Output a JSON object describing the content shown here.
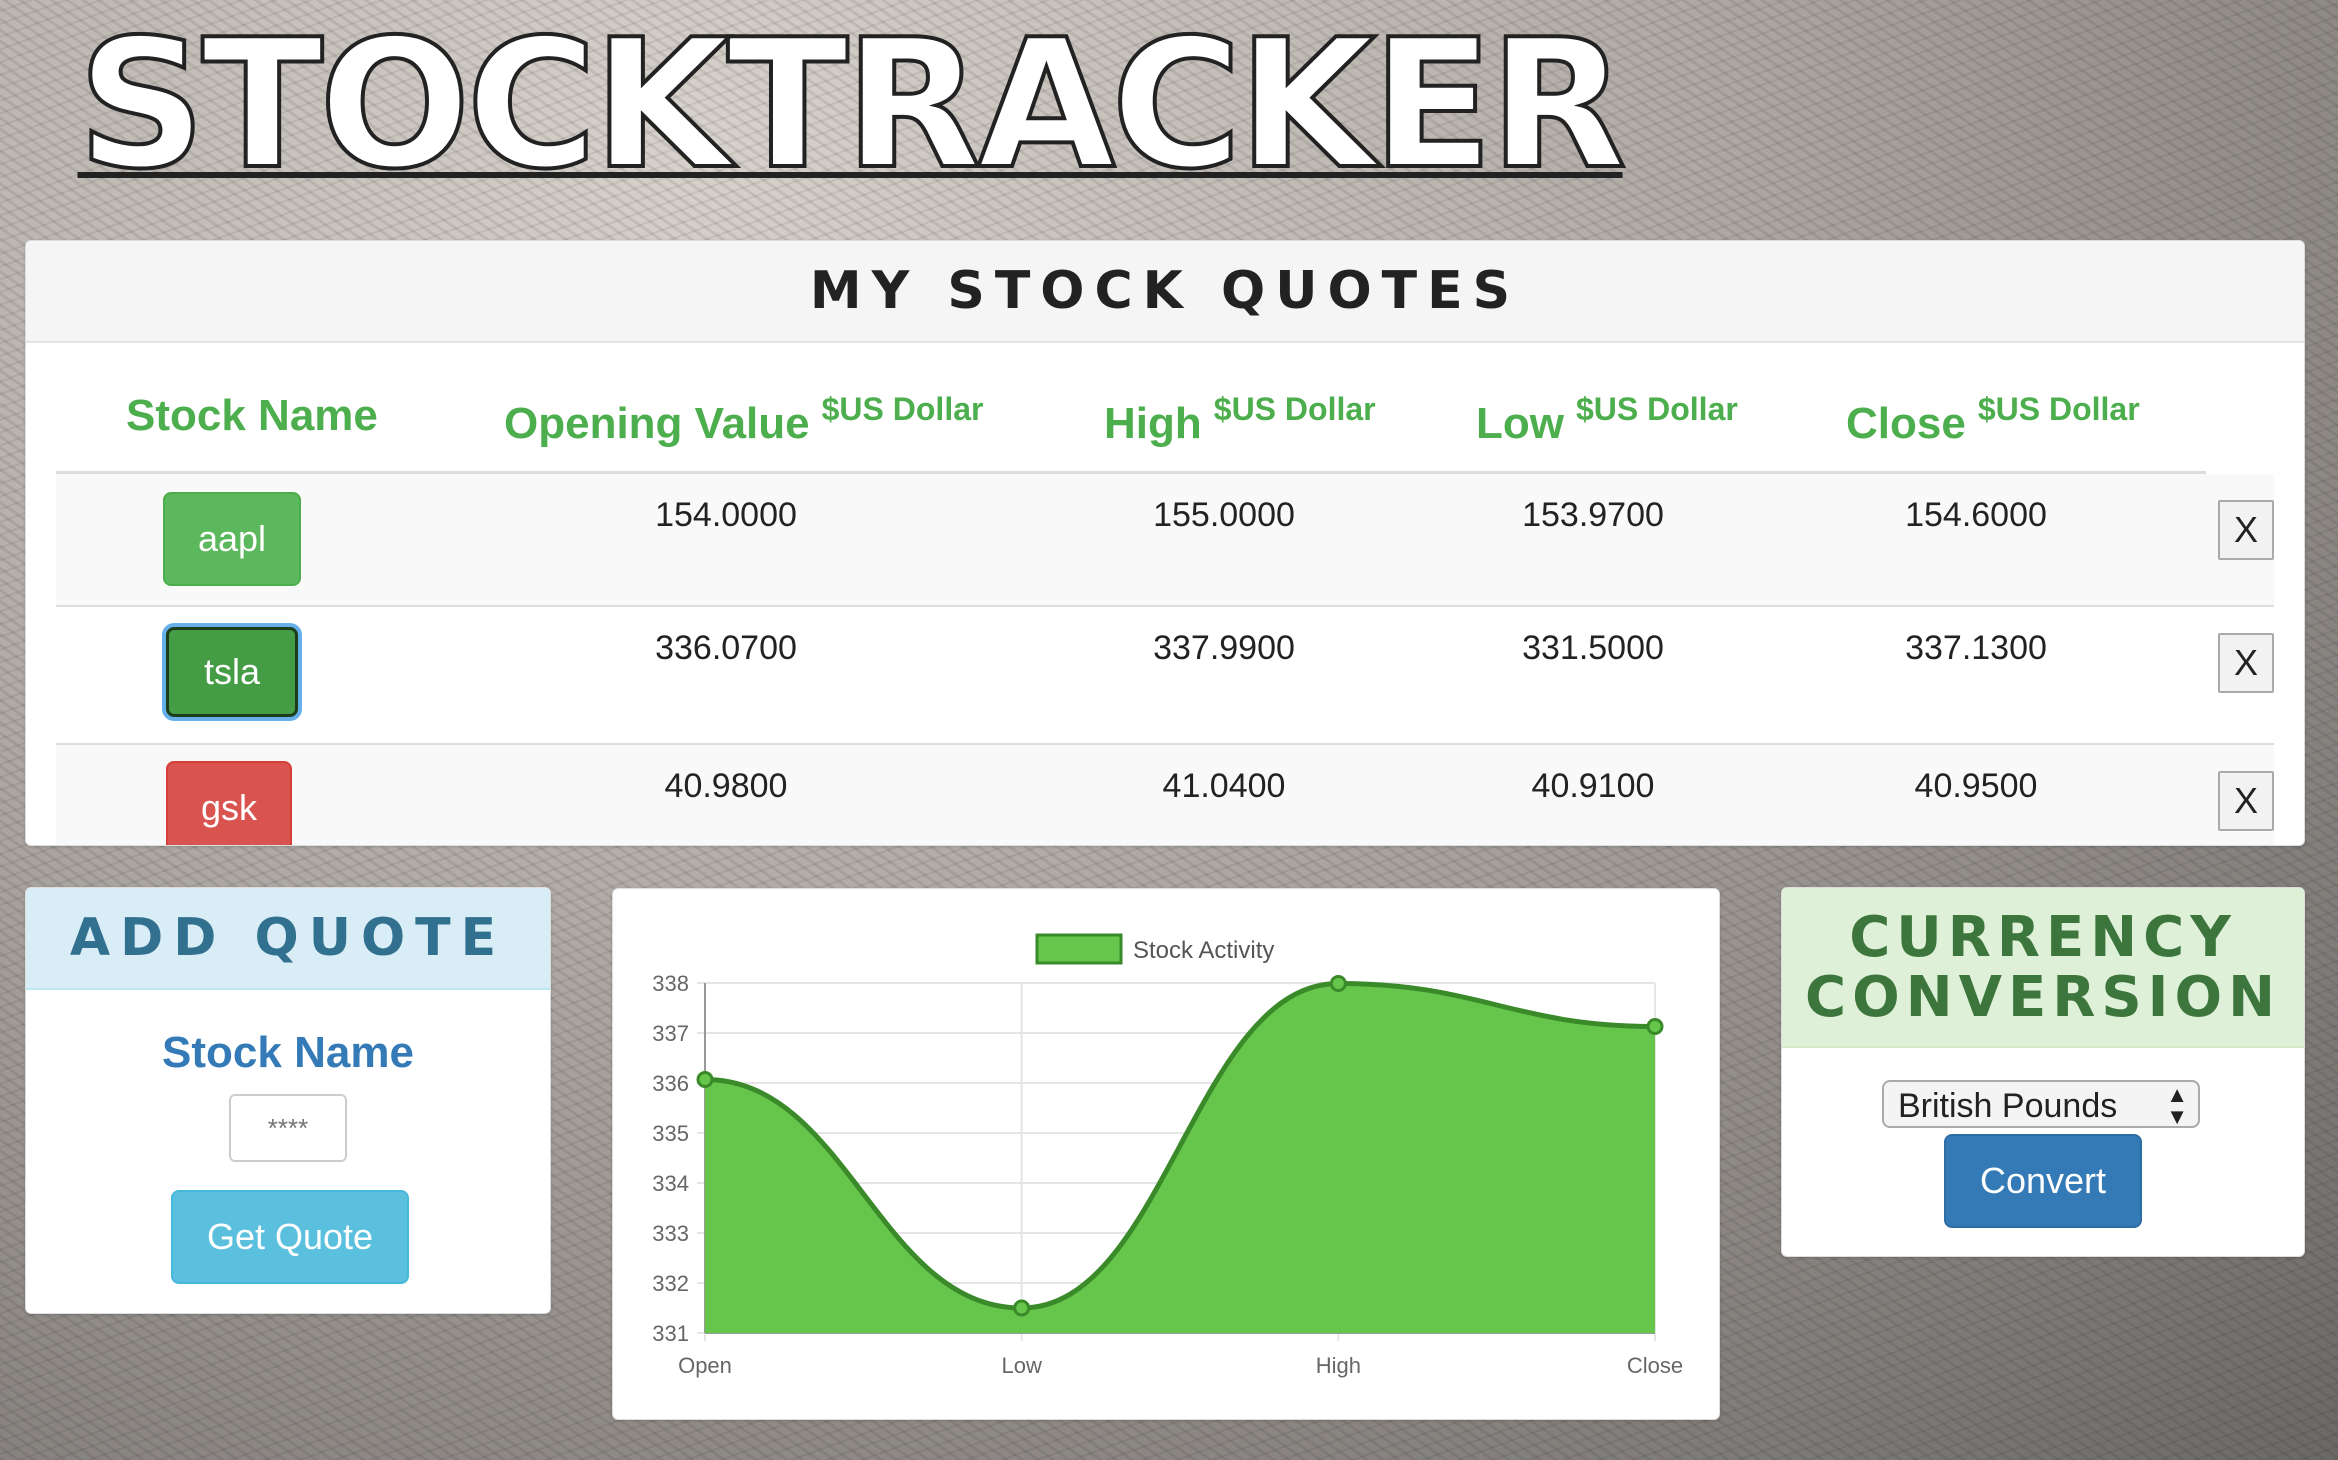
{
  "app": {
    "title": "STOCKTRACKER"
  },
  "quotes": {
    "heading": "MY STOCK QUOTES",
    "columns": {
      "name": "Stock Name",
      "open": "Opening Value",
      "high": "High",
      "low": "Low",
      "close": "Close",
      "unit": "$US Dollar"
    },
    "remove_label": "X",
    "rows": [
      {
        "symbol": "aapl",
        "open": "154.0000",
        "high": "155.0000",
        "low": "153.9700",
        "close": "154.6000"
      },
      {
        "symbol": "tsla",
        "open": "336.0700",
        "high": "337.9900",
        "low": "331.5000",
        "close": "337.1300"
      },
      {
        "symbol": "gsk",
        "open": "40.9800",
        "high": "41.0400",
        "low": "40.9100",
        "close": "40.9500"
      }
    ]
  },
  "add_quote": {
    "heading": "ADD QUOTE",
    "label": "Stock Name",
    "placeholder": "****",
    "button": "Get Quote"
  },
  "currency": {
    "heading_line1": "CURRENCY",
    "heading_line2": "CONVERSION",
    "selected": "British Pounds",
    "button": "Convert"
  },
  "colors": {
    "green": "#5cb85c",
    "chart_fill": "#66c64b",
    "chart_line": "#3a8a2a"
  },
  "chart_data": {
    "type": "area",
    "categories": [
      "Open",
      "Low",
      "High",
      "Close"
    ],
    "series": [
      {
        "name": "Stock Activity",
        "values": [
          336.07,
          331.5,
          337.99,
          337.13
        ]
      }
    ],
    "yticks": [
      331,
      332,
      333,
      334,
      335,
      336,
      337,
      338
    ],
    "ylim": [
      331,
      338
    ],
    "legend": "top"
  }
}
